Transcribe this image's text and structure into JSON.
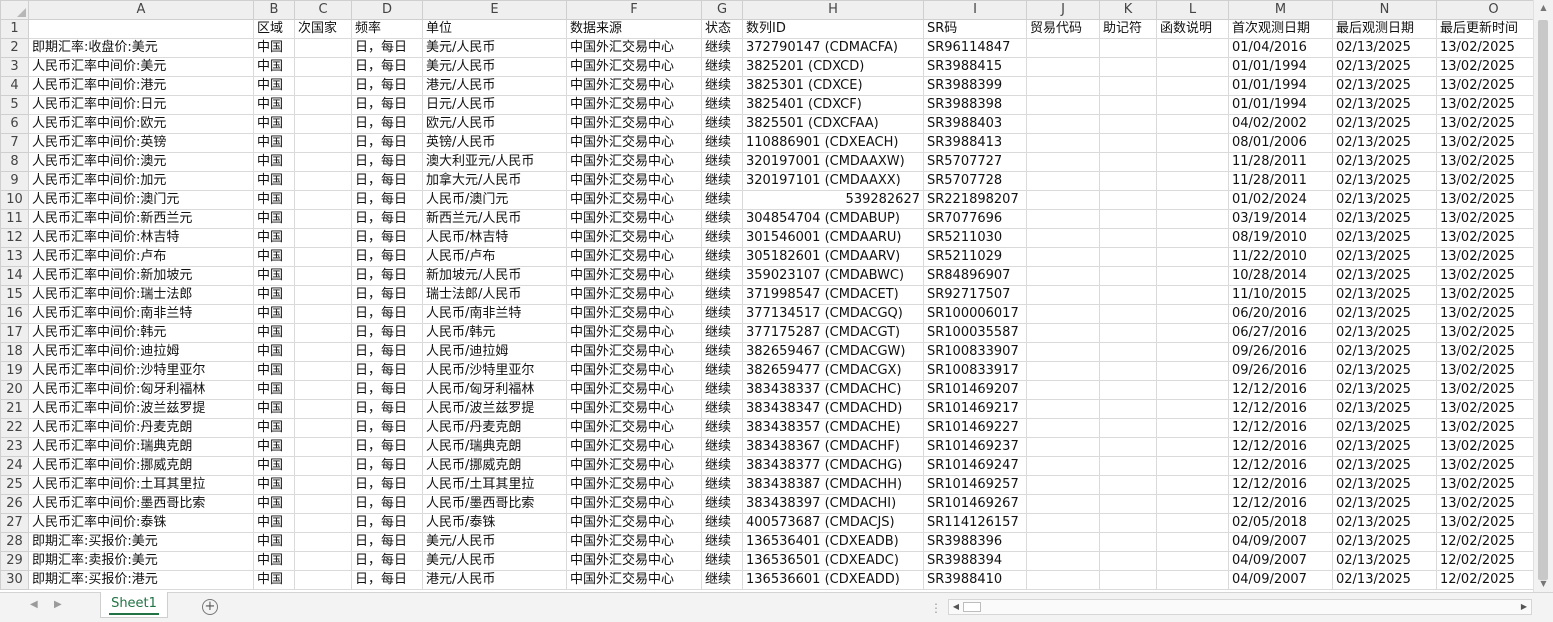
{
  "columns": [
    "A",
    "B",
    "C",
    "D",
    "E",
    "F",
    "G",
    "H",
    "I",
    "J",
    "K",
    "L",
    "M",
    "N",
    "O"
  ],
  "headers": [
    "",
    "区域",
    "次国家",
    "频率",
    "单位",
    "数据来源",
    "状态",
    "数列ID",
    "SR码",
    "贸易代码",
    "助记符",
    "函数说明",
    "首次观测日期",
    "最后观测日期",
    "最后更新时间"
  ],
  "rows": [
    [
      "即期汇率:收盘价:美元",
      "中国",
      "",
      "日，每日",
      "美元/人民币",
      "中国外汇交易中心",
      "继续",
      "372790147 (CDMACFA)",
      "SR96114847",
      "",
      "",
      "",
      "01/04/2016",
      "02/13/2025",
      "13/02/2025"
    ],
    [
      "人民币汇率中间价:美元",
      "中国",
      "",
      "日，每日",
      "美元/人民币",
      "中国外汇交易中心",
      "继续",
      "3825201 (CDXCD)",
      "SR3988415",
      "",
      "",
      "",
      "01/01/1994",
      "02/13/2025",
      "13/02/2025"
    ],
    [
      "人民币汇率中间价:港元",
      "中国",
      "",
      "日，每日",
      "港元/人民币",
      "中国外汇交易中心",
      "继续",
      "3825301 (CDXCE)",
      "SR3988399",
      "",
      "",
      "",
      "01/01/1994",
      "02/13/2025",
      "13/02/2025"
    ],
    [
      "人民币汇率中间价:日元",
      "中国",
      "",
      "日，每日",
      "日元/人民币",
      "中国外汇交易中心",
      "继续",
      "3825401 (CDXCF)",
      "SR3988398",
      "",
      "",
      "",
      "01/01/1994",
      "02/13/2025",
      "13/02/2025"
    ],
    [
      "人民币汇率中间价:欧元",
      "中国",
      "",
      "日，每日",
      "欧元/人民币",
      "中国外汇交易中心",
      "继续",
      "3825501 (CDXCFAA)",
      "SR3988403",
      "",
      "",
      "",
      "04/02/2002",
      "02/13/2025",
      "13/02/2025"
    ],
    [
      "人民币汇率中间价:英镑",
      "中国",
      "",
      "日，每日",
      "英镑/人民币",
      "中国外汇交易中心",
      "继续",
      "110886901 (CDXEACH)",
      "SR3988413",
      "",
      "",
      "",
      "08/01/2006",
      "02/13/2025",
      "13/02/2025"
    ],
    [
      "人民币汇率中间价:澳元",
      "中国",
      "",
      "日，每日",
      "澳大利亚元/人民币",
      "中国外汇交易中心",
      "继续",
      "320197001 (CMDAAXW)",
      "SR5707727",
      "",
      "",
      "",
      "11/28/2011",
      "02/13/2025",
      "13/02/2025"
    ],
    [
      "人民币汇率中间价:加元",
      "中国",
      "",
      "日，每日",
      "加拿大元/人民币",
      "中国外汇交易中心",
      "继续",
      "320197101 (CMDAAXX)",
      "SR5707728",
      "",
      "",
      "",
      "11/28/2011",
      "02/13/2025",
      "13/02/2025"
    ],
    [
      "人民币汇率中间价:澳门元",
      "中国",
      "",
      "日，每日",
      "人民币/澳门元",
      "中国外汇交易中心",
      "继续",
      "539282627",
      "SR221898207",
      "",
      "",
      "",
      "01/02/2024",
      "02/13/2025",
      "13/02/2025"
    ],
    [
      "人民币汇率中间价:新西兰元",
      "中国",
      "",
      "日，每日",
      "新西兰元/人民币",
      "中国外汇交易中心",
      "继续",
      "304854704 (CMDABUP)",
      "SR7077696",
      "",
      "",
      "",
      "03/19/2014",
      "02/13/2025",
      "13/02/2025"
    ],
    [
      "人民币汇率中间价:林吉特",
      "中国",
      "",
      "日，每日",
      "人民币/林吉特",
      "中国外汇交易中心",
      "继续",
      "301546001 (CMDAARU)",
      "SR5211030",
      "",
      "",
      "",
      "08/19/2010",
      "02/13/2025",
      "13/02/2025"
    ],
    [
      "人民币汇率中间价:卢布",
      "中国",
      "",
      "日，每日",
      "人民币/卢布",
      "中国外汇交易中心",
      "继续",
      "305182601 (CMDAARV)",
      "SR5211029",
      "",
      "",
      "",
      "11/22/2010",
      "02/13/2025",
      "13/02/2025"
    ],
    [
      "人民币汇率中间价:新加坡元",
      "中国",
      "",
      "日，每日",
      "新加坡元/人民币",
      "中国外汇交易中心",
      "继续",
      "359023107 (CMDABWC)",
      "SR84896907",
      "",
      "",
      "",
      "10/28/2014",
      "02/13/2025",
      "13/02/2025"
    ],
    [
      "人民币汇率中间价:瑞士法郎",
      "中国",
      "",
      "日，每日",
      "瑞士法郎/人民币",
      "中国外汇交易中心",
      "继续",
      "371998547 (CMDACET)",
      "SR92717507",
      "",
      "",
      "",
      "11/10/2015",
      "02/13/2025",
      "13/02/2025"
    ],
    [
      "人民币汇率中间价:南非兰特",
      "中国",
      "",
      "日，每日",
      "人民币/南非兰特",
      "中国外汇交易中心",
      "继续",
      "377134517 (CMDACGQ)",
      "SR100006017",
      "",
      "",
      "",
      "06/20/2016",
      "02/13/2025",
      "13/02/2025"
    ],
    [
      "人民币汇率中间价:韩元",
      "中国",
      "",
      "日，每日",
      "人民币/韩元",
      "中国外汇交易中心",
      "继续",
      "377175287 (CMDACGT)",
      "SR100035587",
      "",
      "",
      "",
      "06/27/2016",
      "02/13/2025",
      "13/02/2025"
    ],
    [
      "人民币汇率中间价:迪拉姆",
      "中国",
      "",
      "日，每日",
      "人民币/迪拉姆",
      "中国外汇交易中心",
      "继续",
      "382659467 (CMDACGW)",
      "SR100833907",
      "",
      "",
      "",
      "09/26/2016",
      "02/13/2025",
      "13/02/2025"
    ],
    [
      "人民币汇率中间价:沙特里亚尔",
      "中国",
      "",
      "日，每日",
      "人民币/沙特里亚尔",
      "中国外汇交易中心",
      "继续",
      "382659477 (CMDACGX)",
      "SR100833917",
      "",
      "",
      "",
      "09/26/2016",
      "02/13/2025",
      "13/02/2025"
    ],
    [
      "人民币汇率中间价:匈牙利福林",
      "中国",
      "",
      "日，每日",
      "人民币/匈牙利福林",
      "中国外汇交易中心",
      "继续",
      "383438337 (CMDACHC)",
      "SR101469207",
      "",
      "",
      "",
      "12/12/2016",
      "02/13/2025",
      "13/02/2025"
    ],
    [
      "人民币汇率中间价:波兰兹罗提",
      "中国",
      "",
      "日，每日",
      "人民币/波兰兹罗提",
      "中国外汇交易中心",
      "继续",
      "383438347 (CMDACHD)",
      "SR101469217",
      "",
      "",
      "",
      "12/12/2016",
      "02/13/2025",
      "13/02/2025"
    ],
    [
      "人民币汇率中间价:丹麦克朗",
      "中国",
      "",
      "日，每日",
      "人民币/丹麦克朗",
      "中国外汇交易中心",
      "继续",
      "383438357 (CMDACHE)",
      "SR101469227",
      "",
      "",
      "",
      "12/12/2016",
      "02/13/2025",
      "13/02/2025"
    ],
    [
      "人民币汇率中间价:瑞典克朗",
      "中国",
      "",
      "日，每日",
      "人民币/瑞典克朗",
      "中国外汇交易中心",
      "继续",
      "383438367 (CMDACHF)",
      "SR101469237",
      "",
      "",
      "",
      "12/12/2016",
      "02/13/2025",
      "13/02/2025"
    ],
    [
      "人民币汇率中间价:挪威克朗",
      "中国",
      "",
      "日，每日",
      "人民币/挪威克朗",
      "中国外汇交易中心",
      "继续",
      "383438377 (CMDACHG)",
      "SR101469247",
      "",
      "",
      "",
      "12/12/2016",
      "02/13/2025",
      "13/02/2025"
    ],
    [
      "人民币汇率中间价:土耳其里拉",
      "中国",
      "",
      "日，每日",
      "人民币/土耳其里拉",
      "中国外汇交易中心",
      "继续",
      "383438387 (CMDACHH)",
      "SR101469257",
      "",
      "",
      "",
      "12/12/2016",
      "02/13/2025",
      "13/02/2025"
    ],
    [
      "人民币汇率中间价:墨西哥比索",
      "中国",
      "",
      "日，每日",
      "人民币/墨西哥比索",
      "中国外汇交易中心",
      "继续",
      "383438397 (CMDACHI)",
      "SR101469267",
      "",
      "",
      "",
      "12/12/2016",
      "02/13/2025",
      "13/02/2025"
    ],
    [
      "人民币汇率中间价:泰铢",
      "中国",
      "",
      "日，每日",
      "人民币/泰铢",
      "中国外汇交易中心",
      "继续",
      "400573687 (CMDACJS)",
      "SR114126157",
      "",
      "",
      "",
      "02/05/2018",
      "02/13/2025",
      "13/02/2025"
    ],
    [
      "即期汇率:买报价:美元",
      "中国",
      "",
      "日，每日",
      "美元/人民币",
      "中国外汇交易中心",
      "继续",
      "136536401 (CDXEADB)",
      "SR3988396",
      "",
      "",
      "",
      "04/09/2007",
      "02/13/2025",
      "12/02/2025"
    ],
    [
      "即期汇率:卖报价:美元",
      "中国",
      "",
      "日，每日",
      "美元/人民币",
      "中国外汇交易中心",
      "继续",
      "136536501 (CDXEADC)",
      "SR3988394",
      "",
      "",
      "",
      "04/09/2007",
      "02/13/2025",
      "12/02/2025"
    ],
    [
      "即期汇率:买报价:港元",
      "中国",
      "",
      "日，每日",
      "港元/人民币",
      "中国外汇交易中心",
      "继续",
      "136536601 (CDXEADD)",
      "SR3988410",
      "",
      "",
      "",
      "04/09/2007",
      "02/13/2025",
      "12/02/2025"
    ]
  ],
  "sheet_tabs": [
    "Sheet1"
  ],
  "add_sheet_symbol": "+",
  "nav": {
    "prev": "◀",
    "next": "▶"
  },
  "scroll": {
    "up": "▲",
    "down": "▼",
    "left": "◀",
    "right": "▶"
  }
}
